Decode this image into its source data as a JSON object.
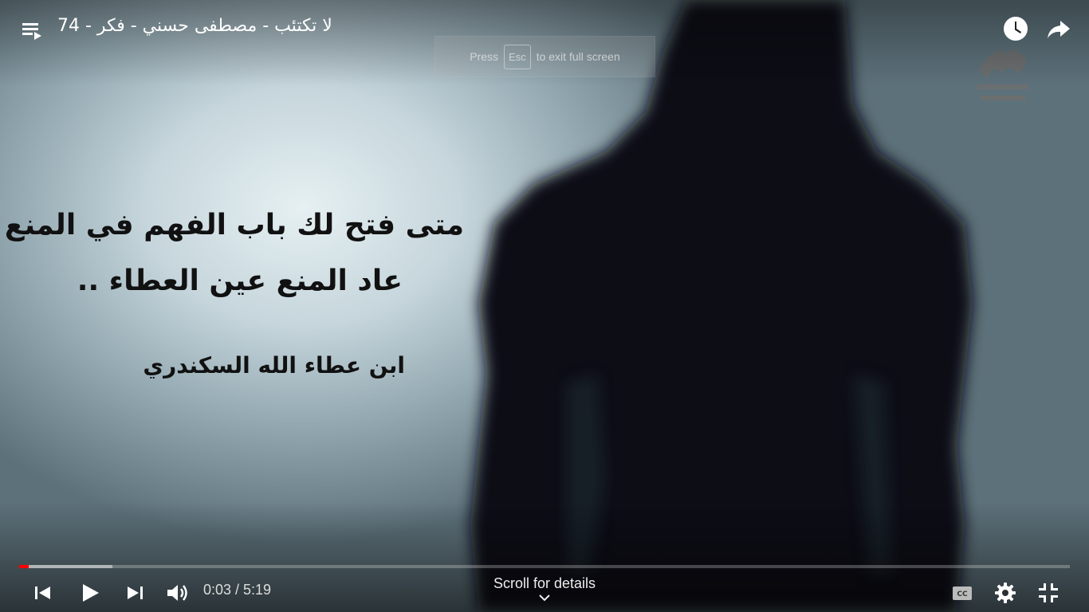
{
  "video": {
    "title": "لا تكتئب - مصطفى حسني - فكر - 74",
    "quote_line1": "متى فتح لك باب الفهم في المنع ..",
    "quote_line2": "عاد المنع عين العطاء ..",
    "quote_author": "ابن عطاء الله السكندري"
  },
  "fullscreen_toast": {
    "before": "Press",
    "key": "Esc",
    "after": "to exit full screen"
  },
  "player": {
    "current_time": "0:03",
    "duration": "5:19",
    "time_display": "0:03 / 5:19",
    "progress_played_fraction": 0.0094,
    "progress_buffered_fraction": 0.089,
    "scroll_label": "Scroll for details",
    "accent_color": "#ff0000"
  },
  "icons": {
    "top_left": "playlist-icon",
    "top_right": [
      "watch-later-icon",
      "share-icon"
    ],
    "controls_left": [
      "previous-icon",
      "play-icon",
      "next-icon",
      "volume-icon"
    ],
    "controls_right": [
      "captions-icon",
      "settings-icon",
      "exit-fullscreen-icon"
    ]
  }
}
